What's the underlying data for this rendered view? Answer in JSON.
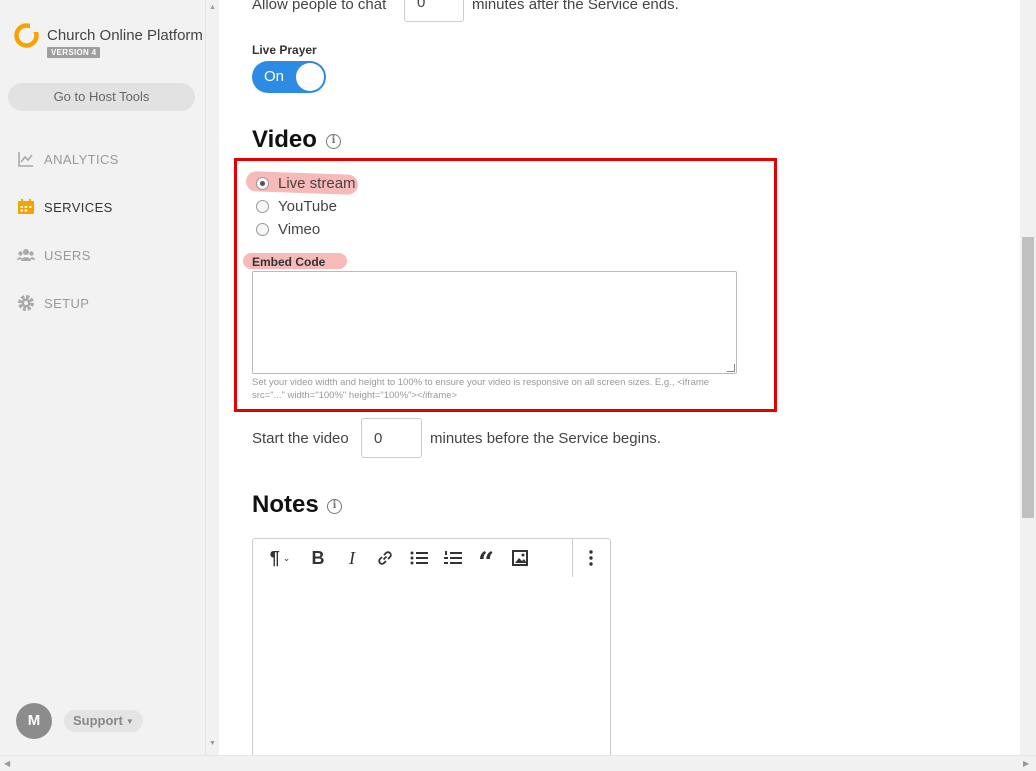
{
  "app": {
    "brand": "Church Online Platform",
    "version": "VERSION 4",
    "host_tools": "Go to Host Tools"
  },
  "nav": {
    "analytics": "ANALYTICS",
    "services": "SERVICES",
    "users": "USERS",
    "setup": "SETUP"
  },
  "user": {
    "avatar_initial": "M",
    "support": "Support"
  },
  "chat": {
    "prefix": "Allow people to chat",
    "value": "0",
    "suffix": "minutes after the Service ends."
  },
  "live_prayer": {
    "label": "Live Prayer",
    "toggle": "On"
  },
  "video": {
    "heading": "Video",
    "options": [
      "Live stream",
      "YouTube",
      "Vimeo"
    ],
    "selected": "Live stream",
    "embed_label": "Embed Code",
    "embed_value": "",
    "hint": "Set your video width and height to 100% to ensure your video is responsive on all screen sizes. E.g., <iframe src=\"...\" width=\"100%\" height=\"100%\"></iframe>",
    "start_prefix": "Start the video",
    "start_value": "0",
    "start_suffix": "minutes before the Service begins."
  },
  "notes": {
    "heading": "Notes"
  },
  "colors": {
    "accent": "#2d8be3",
    "brand_orange": "#f7a200",
    "highlight": "#e50000"
  }
}
